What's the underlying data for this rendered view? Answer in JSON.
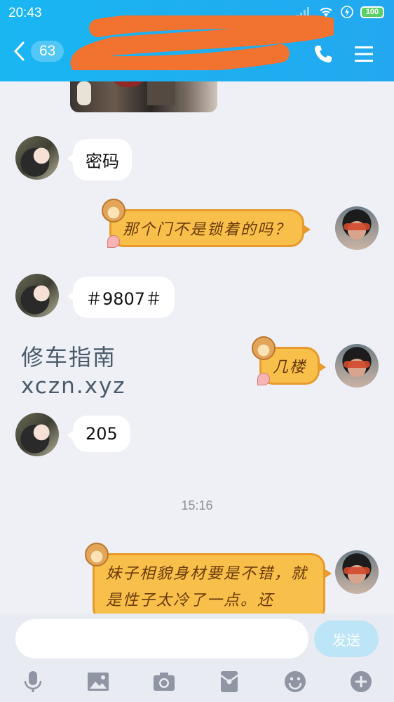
{
  "status_bar": {
    "time": "20:43",
    "battery": "100"
  },
  "header": {
    "unread_count": "63",
    "icons": [
      "back-chevron-icon",
      "phone-icon",
      "menu-icon"
    ]
  },
  "messages": [
    {
      "from": "contact",
      "text": "密码"
    },
    {
      "from": "me",
      "text": "那个门不是锁着的吗？"
    },
    {
      "from": "contact",
      "text": "＃9807＃"
    },
    {
      "from": "me",
      "text": "几楼"
    },
    {
      "from": "contact",
      "text": "205"
    },
    {
      "from": "me",
      "text": "妹子相貌身材要是不错，就是性子太冷了一点。还"
    }
  ],
  "watermark": {
    "line1": "修车指南",
    "line2": "xczn.xyz"
  },
  "timestamp": "15:16",
  "input": {
    "value": "",
    "send_label": "发送"
  },
  "toolbar_icons": [
    "microphone-icon",
    "image-icon",
    "camera-icon",
    "red-packet-icon",
    "emoji-icon",
    "plus-icon"
  ],
  "colors": {
    "header": "#19b6f2",
    "bubble_out": "#f8c04a",
    "bubble_out_border": "#e89a2c",
    "send_disabled": "#bde5f8"
  }
}
